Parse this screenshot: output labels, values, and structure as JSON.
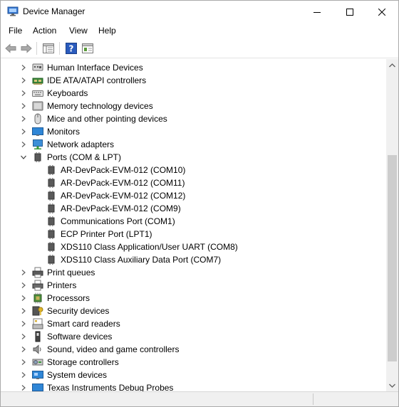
{
  "window": {
    "title": "Device Manager"
  },
  "menu": {
    "file": "File",
    "action": "Action",
    "view": "View",
    "help": "Help"
  },
  "tree": {
    "human_interface": "Human Interface Devices",
    "ide": "IDE ATA/ATAPI controllers",
    "keyboards": "Keyboards",
    "memory": "Memory technology devices",
    "mice": "Mice and other pointing devices",
    "monitors": "Monitors",
    "network": "Network adapters",
    "ports": "Ports (COM & LPT)",
    "port_items": [
      "AR-DevPack-EVM-012 (COM10)",
      "AR-DevPack-EVM-012 (COM11)",
      "AR-DevPack-EVM-012 (COM12)",
      "AR-DevPack-EVM-012 (COM9)",
      "Communications Port (COM1)",
      "ECP Printer Port (LPT1)",
      "XDS110 Class Application/User UART (COM8)",
      "XDS110 Class Auxiliary Data Port (COM7)"
    ],
    "print_queues": "Print queues",
    "printers": "Printers",
    "processors": "Processors",
    "security": "Security devices",
    "smart_card": "Smart card readers",
    "software": "Software devices",
    "sound": "Sound, video and game controllers",
    "storage": "Storage controllers",
    "system": "System devices",
    "texas": "Texas Instruments Debug Probes"
  },
  "colors": {
    "accent": "#1a64c8",
    "chevron": "#606060"
  }
}
